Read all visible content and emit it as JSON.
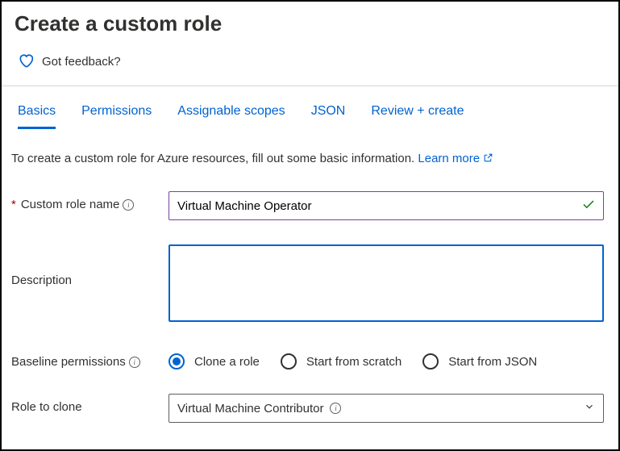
{
  "header": {
    "title": "Create a custom role"
  },
  "feedback": {
    "label": "Got feedback?"
  },
  "tabs": [
    {
      "label": "Basics",
      "active": true
    },
    {
      "label": "Permissions"
    },
    {
      "label": "Assignable scopes"
    },
    {
      "label": "JSON"
    },
    {
      "label": "Review + create"
    }
  ],
  "intro": {
    "text": "To create a custom role for Azure resources, fill out some basic information. ",
    "link": "Learn more"
  },
  "form": {
    "role_name": {
      "label": "Custom role name",
      "value": "Virtual Machine Operator"
    },
    "description": {
      "label": "Description",
      "value": ""
    },
    "baseline": {
      "label": "Baseline permissions",
      "options": [
        {
          "label": "Clone a role",
          "selected": true
        },
        {
          "label": "Start from scratch",
          "selected": false
        },
        {
          "label": "Start from JSON",
          "selected": false
        }
      ]
    },
    "clone": {
      "label": "Role to clone",
      "value": "Virtual Machine Contributor"
    }
  }
}
